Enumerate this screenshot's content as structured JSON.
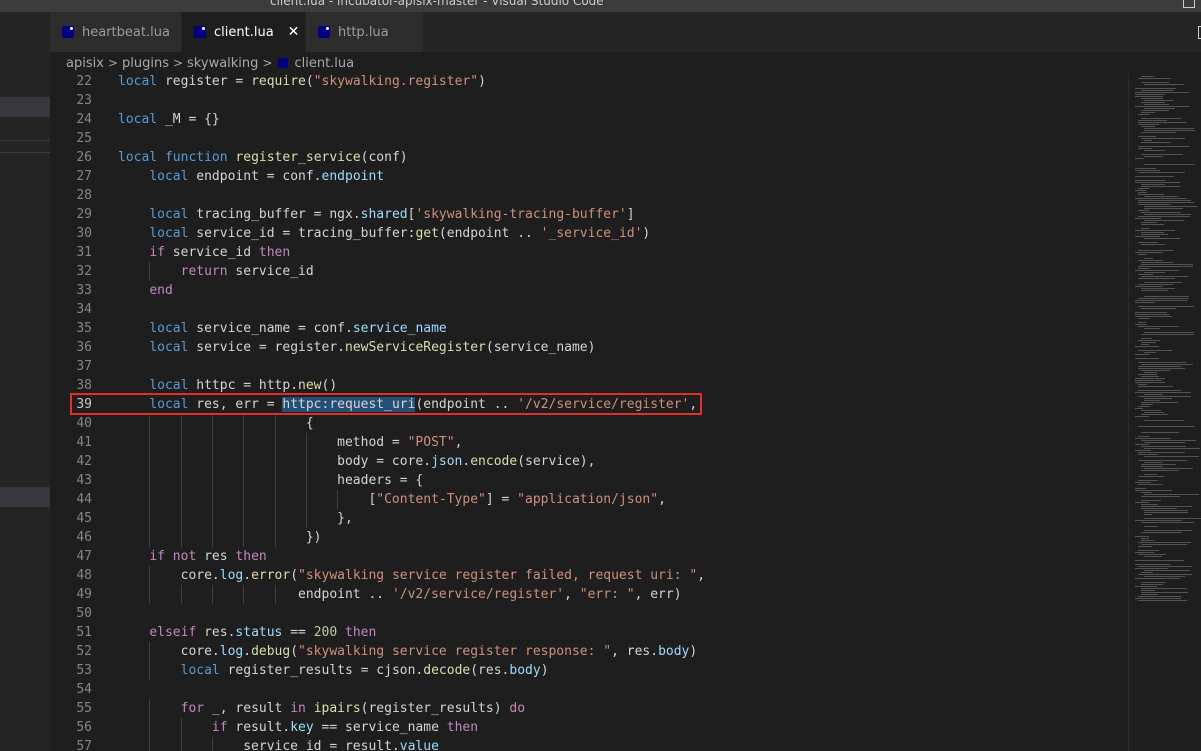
{
  "window": {
    "title": "client.lua - incubator-apisix-master - Visual Studio Code"
  },
  "tabs": [
    {
      "label": "heartbeat.lua",
      "active": false
    },
    {
      "label": "client.lua",
      "active": true,
      "close": "✕"
    },
    {
      "label": "http.lua",
      "active": false
    }
  ],
  "breadcrumbs": [
    "apisix",
    "plugins",
    "skywalking",
    "client.lua"
  ],
  "editor": {
    "language": "lua",
    "highlighted_line": 39,
    "selection_text": "httpc:request_uri",
    "lines": [
      {
        "n": "22",
        "t": "local register = require(\"skywalking.register\")"
      },
      {
        "n": "23",
        "t": ""
      },
      {
        "n": "24",
        "t": "local _M = {}"
      },
      {
        "n": "25",
        "t": ""
      },
      {
        "n": "26",
        "t": "local function register_service(conf)"
      },
      {
        "n": "27",
        "t": "    local endpoint = conf.endpoint"
      },
      {
        "n": "28",
        "t": ""
      },
      {
        "n": "29",
        "t": "    local tracing_buffer = ngx.shared['skywalking-tracing-buffer']"
      },
      {
        "n": "30",
        "t": "    local service_id = tracing_buffer:get(endpoint .. '_service_id')"
      },
      {
        "n": "31",
        "t": "    if service_id then"
      },
      {
        "n": "32",
        "t": "        return service_id"
      },
      {
        "n": "33",
        "t": "    end"
      },
      {
        "n": "34",
        "t": ""
      },
      {
        "n": "35",
        "t": "    local service_name = conf.service_name"
      },
      {
        "n": "36",
        "t": "    local service = register.newServiceRegister(service_name)"
      },
      {
        "n": "37",
        "t": ""
      },
      {
        "n": "38",
        "t": "    local httpc = http.new()"
      },
      {
        "n": "39",
        "t": "    local res, err = httpc:request_uri(endpoint .. '/v2/service/register',"
      },
      {
        "n": "40",
        "t": "                        {"
      },
      {
        "n": "41",
        "t": "                            method = \"POST\","
      },
      {
        "n": "42",
        "t": "                            body = core.json.encode(service),"
      },
      {
        "n": "43",
        "t": "                            headers = {"
      },
      {
        "n": "44",
        "t": "                                [\"Content-Type\"] = \"application/json\","
      },
      {
        "n": "45",
        "t": "                            },"
      },
      {
        "n": "46",
        "t": "                        })"
      },
      {
        "n": "47",
        "t": "    if not res then"
      },
      {
        "n": "48",
        "t": "        core.log.error(\"skywalking service register failed, request uri: \","
      },
      {
        "n": "49",
        "t": "                       endpoint .. '/v2/service/register', \"err: \", err)"
      },
      {
        "n": "50",
        "t": ""
      },
      {
        "n": "51",
        "t": "    elseif res.status == 200 then"
      },
      {
        "n": "52",
        "t": "        core.log.debug(\"skywalking service register response: \", res.body)"
      },
      {
        "n": "53",
        "t": "        local register_results = cjson.decode(res.body)"
      },
      {
        "n": "54",
        "t": ""
      },
      {
        "n": "55",
        "t": "        for _, result in ipairs(register_results) do"
      },
      {
        "n": "56",
        "t": "            if result.key == service_name then"
      },
      {
        "n": "57",
        "t": "                service_id = result.value"
      }
    ]
  },
  "colors": {
    "background": "#1e1e1e",
    "keyword": "#c586c0",
    "local_keyword": "#569cd6",
    "string": "#ce9178",
    "function": "#dcdcaa",
    "property": "#9cdcfe",
    "number": "#b5cea8",
    "annotation_box": "#e0302a",
    "selection": "#264f78"
  }
}
